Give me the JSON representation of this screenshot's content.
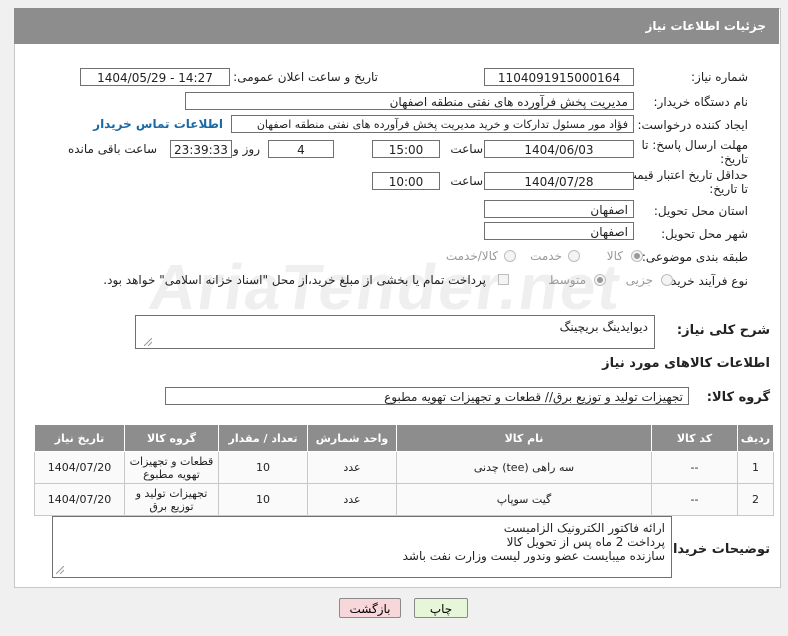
{
  "header": {
    "title": "جزئیات اطلاعات نیاز"
  },
  "form": {
    "need_number_label": "شماره نیاز:",
    "need_number": "1104091915000164",
    "announce_label": "تاریخ و ساعت اعلان عمومی:",
    "announce_value": "1404/05/29 - 14:27",
    "buyer_org_label": "نام دستگاه خریدار:",
    "buyer_org": "مدیریت پخش فرآورده های نفتی منطقه اصفهان",
    "creator_label": "ایجاد کننده درخواست:",
    "creator": "فؤاد مور مسئول تداركات و خريد مديريت پخش فرآورده هاى نفتى منطقه اصفهان",
    "contact_link": "اطلاعات تماس خریدار",
    "reply_deadline_label_1": "مهلت ارسال پاسخ: تا",
    "reply_deadline_label_2": "تاریخ:",
    "reply_date": "1404/06/03",
    "time_label": "ساعت",
    "reply_time": "15:00",
    "days_value": "4",
    "days_label": "روز و",
    "remaining_time": "23:39:33",
    "remaining_label": "ساعت باقی مانده",
    "price_validity_label_1": "حداقل تاریخ اعتبار قیمت:",
    "price_validity_label_2": "تا تاریخ:",
    "price_validity_date": "1404/07/28",
    "price_validity_time": "10:00",
    "province_label": "استان محل تحویل:",
    "province": "اصفهان",
    "city_label": "شهر محل تحویل:",
    "city": "اصفهان",
    "category_label": "طبقه بندی موضوعی:",
    "category_options": [
      "کالا",
      "خدمت",
      "کالا/خدمت"
    ],
    "process_label": "نوع فرآیند خرید :",
    "process_options": [
      "جزیی",
      "متوسط"
    ],
    "payment_note": "پرداخت تمام یا بخشی از مبلغ خرید،از محل \"اسناد خزانه اسلامی\" خواهد بود.",
    "description_label": "شرح کلی نیاز:",
    "description": "دیوایدینگ بریچینگ"
  },
  "goods": {
    "section_title": "اطلاعات کالاهای مورد نیاز",
    "group_label": "گروه کالا:",
    "group_value": "تجهیزات تولید و توزیع برق// قطعات و تجهیزات تهویه مطبوع",
    "columns": [
      "ردیف",
      "کد کالا",
      "نام کالا",
      "واحد شمارش",
      "تعداد / مقدار",
      "گروه کالا",
      "تاریخ نیاز"
    ],
    "rows": [
      [
        "1",
        "--",
        "سه راهی (tee) چدنی",
        "عدد",
        "10",
        "قطعات و تجهیزات تهویه مطبوع",
        "1404/07/20"
      ],
      [
        "2",
        "--",
        "گیت سوپاپ",
        "عدد",
        "10",
        "تجهیزات تولید و توزیع برق",
        "1404/07/20"
      ]
    ]
  },
  "buyer_notes": {
    "label": "توضیحات خریدار:",
    "lines": [
      "ارائه فاکتور الکترونیک الزامیست",
      "پرداخت 2 ماه پس از تحویل کالا",
      "سازنده میبایست عضو وندور لیست وزارت نفت باشد"
    ]
  },
  "buttons": {
    "print": "چاپ",
    "back": "بازگشت"
  },
  "watermark": "AriaTender.net",
  "colors": {
    "header_bg": "#8d8d8d",
    "link": "#1a6aa8",
    "back_btn": "#f8d7da",
    "print_btn": "#e6f6d9"
  }
}
